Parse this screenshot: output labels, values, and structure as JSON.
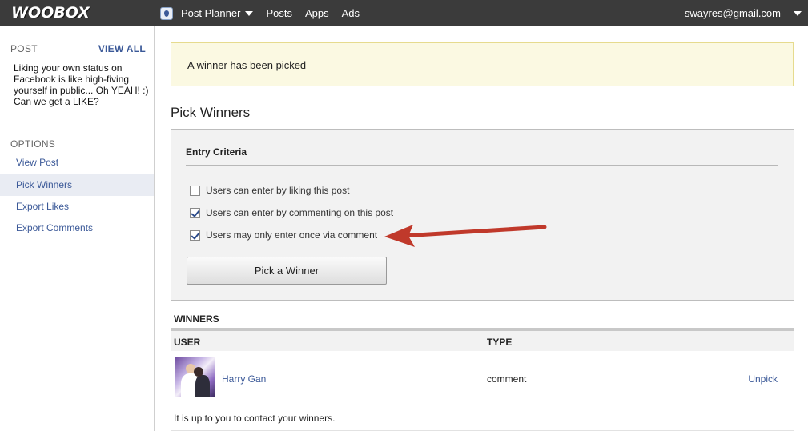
{
  "topbar": {
    "logo": "WOOBOX",
    "nav": [
      "Post Planner",
      "Posts",
      "Apps",
      "Ads"
    ],
    "user_email": "swayres@gmail.com",
    "icons": {
      "app": "post-planner-app-icon",
      "caret": "chevron-down-icon"
    }
  },
  "sidebar": {
    "post_heading": "POST",
    "view_all": "VIEW ALL",
    "post_text": "Liking your own status on Facebook is like high-fiving yourself in public... Oh YEAH! :) Can we get a LIKE?",
    "options_heading": "OPTIONS",
    "options": [
      {
        "label": "View Post",
        "active": false
      },
      {
        "label": "Pick Winners",
        "active": true
      },
      {
        "label": "Export Likes",
        "active": false
      },
      {
        "label": "Export Comments",
        "active": false
      }
    ]
  },
  "main": {
    "banner": "A winner has been picked",
    "title": "Pick Winners",
    "criteria": {
      "title": "Entry Criteria",
      "options": [
        {
          "label": "Users can enter by liking this post",
          "checked": false
        },
        {
          "label": "Users can enter by commenting on this post",
          "checked": true
        },
        {
          "label": "Users may only enter once via comment",
          "checked": true
        }
      ],
      "button": "Pick a Winner"
    },
    "winners": {
      "heading": "WINNERS",
      "columns": [
        "USER",
        "TYPE"
      ],
      "rows": [
        {
          "name": "Harry Gan",
          "type": "comment",
          "action": "Unpick"
        }
      ],
      "note": "It is up to you to contact your winners."
    }
  },
  "colors": {
    "topbar": "#3b3b3b",
    "link": "#3b5998",
    "banner_bg": "#fbf9e2",
    "banner_border": "#e6db8e",
    "arrow": "#c0392b"
  }
}
